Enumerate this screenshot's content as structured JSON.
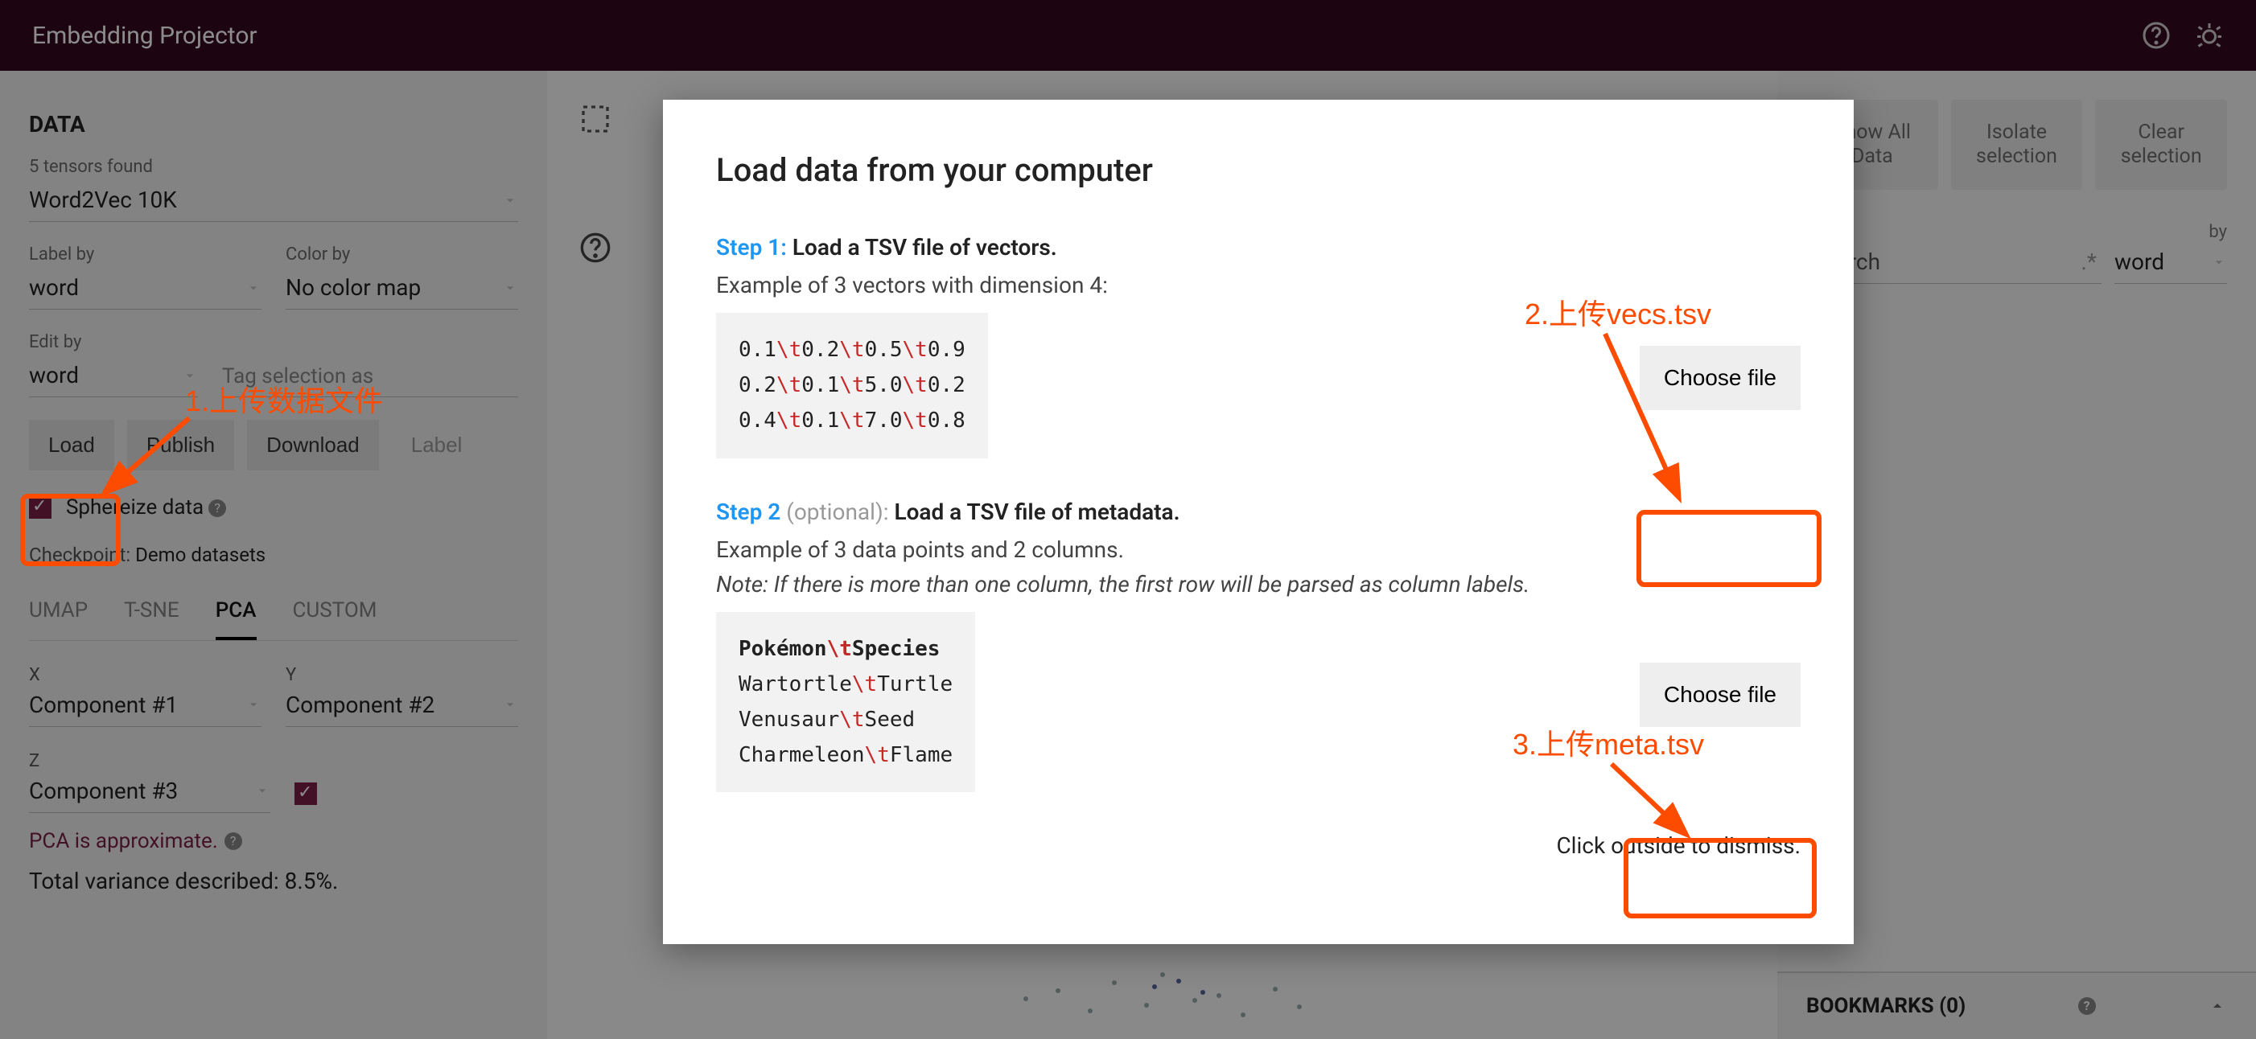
{
  "header": {
    "title": "Embedding Projector"
  },
  "sidebar": {
    "title": "DATA",
    "tensors_found": "5 tensors found",
    "tensor_select": "Word2Vec 10K",
    "label_by_label": "Label by",
    "label_by_value": "word",
    "color_by_label": "Color by",
    "color_by_value": "No color map",
    "edit_by_label": "Edit by",
    "edit_by_value": "word",
    "tag_placeholder": "Tag selection as",
    "buttons": {
      "load": "Load",
      "publish": "Publish",
      "download": "Download",
      "label": "Label"
    },
    "sphereize": "Sphereize data",
    "checkpoint_label": "Checkpoint:",
    "checkpoint_value": "Demo datasets",
    "tabs": [
      "UMAP",
      "T-SNE",
      "PCA",
      "CUSTOM"
    ],
    "active_tab": "PCA",
    "x_label": "X",
    "y_label": "Y",
    "z_label": "Z",
    "x_val": "Component #1",
    "y_val": "Component #2",
    "z_val": "Component #3",
    "pca_note": "PCA is approximate.",
    "variance": "Total variance described: 8.5%."
  },
  "right": {
    "show_all": "Show All Data",
    "isolate": "Isolate selection",
    "clear": "Clear selection",
    "by_label": "by",
    "by_value": "word",
    "search_placeholder": "Search",
    "bookmarks": "BOOKMARKS (0)"
  },
  "modal": {
    "title": "Load data from your computer",
    "step1_kw": "Step 1:",
    "step1_title": "Load a TSV file of vectors.",
    "step1_example": "Example of 3 vectors with dimension 4:",
    "step1_code_plain": "0.1\\t0.2\\t0.5\\t0.9\n0.2\\t0.1\\t5.0\\t0.2\n0.4\\t0.1\\t7.0\\t0.8",
    "choose1": "Choose file",
    "step2_kw": "Step 2",
    "step2_optional": "(optional):",
    "step2_title": "Load a TSV file of metadata.",
    "step2_example": "Example of 3 data points and 2 columns.",
    "step2_note": "Note: If there is more than one column, the first row will be parsed as column labels.",
    "step2_code_plain": "Pokémon\\tSpecies\nWartortle\\tTurtle\nVenusaur\\tSeed\nCharmeleon\\tFlame",
    "choose2": "Choose file",
    "dismiss": "Click outside to dismiss."
  },
  "annotations": {
    "a1": "1.上传数据文件",
    "a2": "2.上传vecs.tsv",
    "a3": "3.上传meta.tsv"
  }
}
